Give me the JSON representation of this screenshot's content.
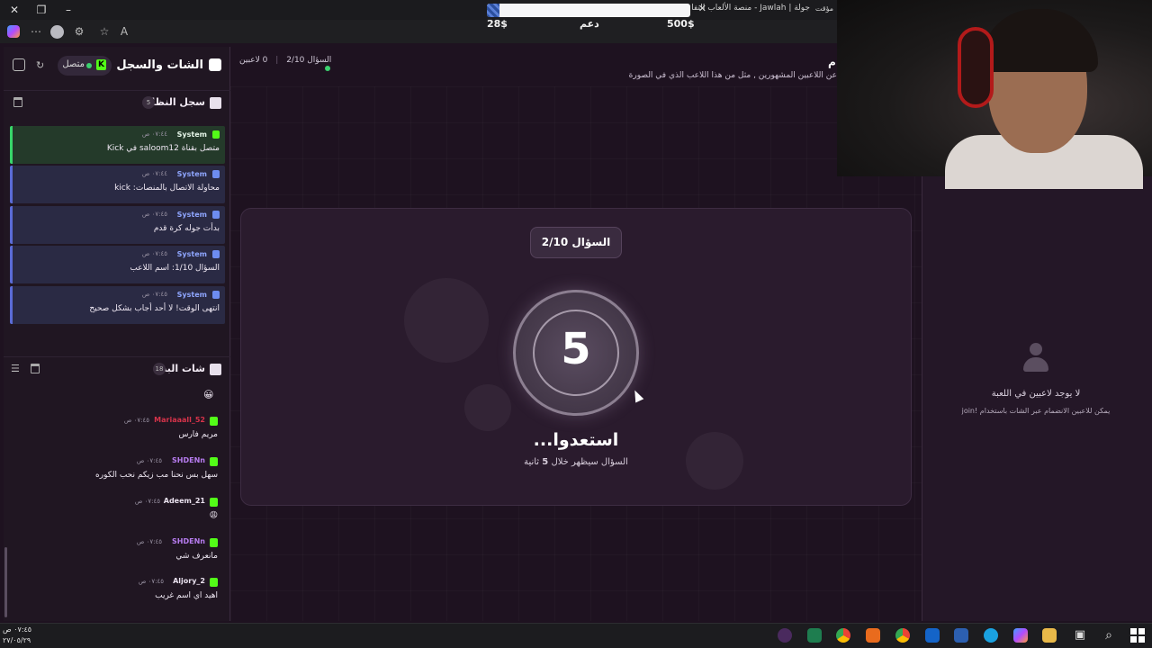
{
  "browser": {
    "tab_title": "جولة | Jawlah - منصة الألعاب التفا",
    "tab_prefix": "مؤقت",
    "reader_label": "A"
  },
  "donation": {
    "progress": 0.06,
    "current": "28$",
    "label": "دعم",
    "goal": "500$"
  },
  "left_panel": {
    "title": "الشات والسجل",
    "connection": "متصل",
    "system_log": {
      "title": "سجل النظام",
      "count": "5",
      "messages": [
        {
          "who": "System",
          "time": "٠٧:٤٤ ص",
          "text": "متصل بقناة saloom12 في Kick",
          "kind": "kick"
        },
        {
          "who": "System",
          "time": "٠٧:٤٤ ص",
          "text": "محاولة الاتصال بالمنصات: kick",
          "kind": "system"
        },
        {
          "who": "System",
          "time": "٠٧:٤٥ ص",
          "text": "بدأت جوله كرة قدم",
          "kind": "system"
        },
        {
          "who": "System",
          "time": "٠٧:٤٥ ص",
          "text": "السؤال 1/10: اسم اللاعب",
          "kind": "system"
        },
        {
          "who": "System",
          "time": "٠٧:٤٥ ص",
          "text": "انتهى الوقت! لا أحد أجاب بشكل صحيح",
          "kind": "system"
        }
      ]
    },
    "stream_chat": {
      "title": "شات البث",
      "count": "18",
      "top_emoji": "😀",
      "messages": [
        {
          "who": "Mariaaall_52",
          "time": "٠٧:٤٥ ص",
          "text": "مريم فارس",
          "color": "#d6334a"
        },
        {
          "who": "SHDENn",
          "time": "٠٧:٤٥ ص",
          "text": "سهل بس نحنا مب زيكم نحب الكوره",
          "color": "#b77cf0"
        },
        {
          "who": "Adeem_21",
          "time": "٠٧:٤٥ ص",
          "text": "😩",
          "color": "#e9e1ee"
        },
        {
          "who": "SHDENn",
          "time": "٠٧:٤٥ ص",
          "text": "مانعرف شي",
          "color": "#b77cf0"
        },
        {
          "who": "Aljory_2",
          "time": "٠٧:٤٥ ص",
          "text": "اهيد اي اسم غريب",
          "color": "#e9e1ee"
        }
      ]
    }
  },
  "status": {
    "players": "0 لاعبين",
    "question": "السؤال 2/10",
    "header_title_fragment": "م",
    "header_desc": "عن اللاعبين المشهورين , مثل من هذا اللاعب الذي في الصورة"
  },
  "game": {
    "question_pill": "السؤال 2/10",
    "countdown": "5",
    "ready_title": "استعدوا...",
    "ready_sub_before": "السؤال سيظهر خلال",
    "ready_sub_number": "5",
    "ready_sub_after": "ثانية"
  },
  "right_panel": {
    "no_players_title": "لا يوجد لاعبين في اللعبة",
    "no_players_sub": "يمكن للاعبين الانضمام عبر الشات باستخدام !join"
  },
  "taskbar": {
    "time": "٠٧:٤٥ ص",
    "date": "٢٧/٠٥/٢٩"
  }
}
